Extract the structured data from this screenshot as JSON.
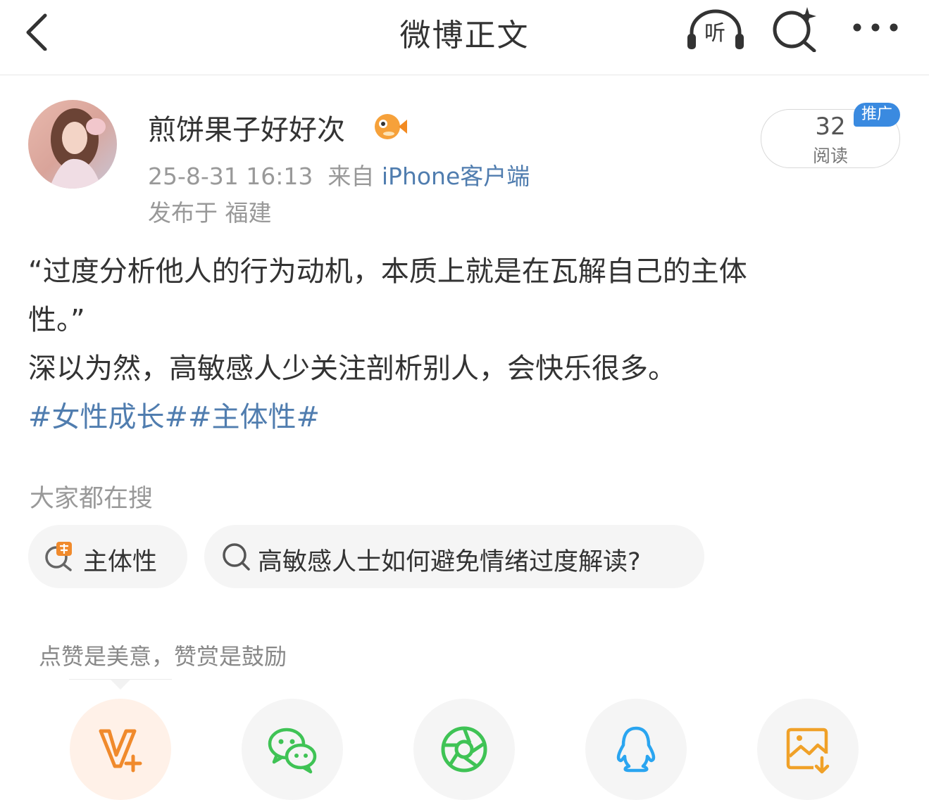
{
  "header": {
    "title": "微博正文",
    "listen_label": "听",
    "icons": [
      "back-chevron-icon",
      "headphones-icon",
      "search-sparkle-icon",
      "more-dots-icon"
    ]
  },
  "author": {
    "name": "煎饼果子好好次",
    "badge_icon": "pufferfish-icon",
    "time": "25-8-31 16:13",
    "source_prefix": "来自",
    "device": "iPhone客户端",
    "location": "发布于 福建"
  },
  "stats": {
    "read_count": "32",
    "read_label": "阅读",
    "promo_badge": "推广"
  },
  "post": {
    "line1": "“过度分析他人的行为动机，本质上就是在瓦解自己的主体",
    "line2": "性。”",
    "line3": "深以为然，高敏感人少关注剖析别人，会快乐很多。",
    "tags": "#女性成长##主体性#"
  },
  "search": {
    "label": "大家都在搜",
    "chips": [
      {
        "text": "主体性",
        "icon": "hot-search-icon"
      },
      {
        "text": "高敏感人士如何避免情绪过度解读?",
        "icon": "search-icon"
      }
    ]
  },
  "reward": {
    "text": "点赞是美意，赞赏是鼓励"
  },
  "share": {
    "items": [
      "vplus-icon",
      "wechat-icon",
      "moments-icon",
      "qq-icon",
      "save-image-icon"
    ]
  },
  "colors": {
    "link": "#507daf",
    "accent_orange": "#f08a2c",
    "wechat_green": "#3fc355",
    "qq_blue": "#2aa5f0",
    "promo_blue": "#3a8ae0"
  }
}
